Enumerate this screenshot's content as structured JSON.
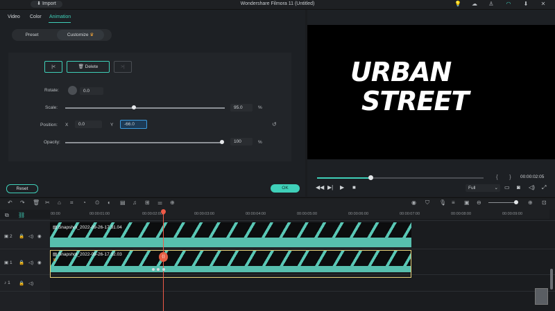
{
  "titlebar": {
    "import_label": "Import",
    "app_title": "Wondershare Filmora 11 (Untitled)"
  },
  "panel": {
    "tabs": [
      "Video",
      "Color",
      "Animation"
    ],
    "active_tab": "Animation",
    "subtabs": [
      "Preset",
      "Customize"
    ],
    "active_subtab": "Customize",
    "keyframe": {
      "delete_label": "Delete"
    },
    "rotate": {
      "label": "Rotate:",
      "value": "0.0"
    },
    "scale": {
      "label": "Scale:",
      "value": "95.0",
      "unit": "%",
      "level": 0.43
    },
    "position": {
      "label": "Position:",
      "x_label": "X",
      "x_value": "0.0",
      "y_label": "Y",
      "y_value": "-66.0"
    },
    "opacity": {
      "label": "Opacity:",
      "value": "100",
      "unit": "%",
      "level": 1.0
    },
    "reset_label": "Reset",
    "ok_label": "OK"
  },
  "preview": {
    "title_line1": "URBAN",
    "title_line2": "STREET",
    "timecode": "00:00:02:05",
    "progress": 0.32,
    "zoom": "Full"
  },
  "timeline": {
    "ruler": [
      "00:00",
      "00:00:01:00",
      "00:00:02:00",
      "00:00:03:00",
      "00:00:04:00",
      "00:00:05:00",
      "00:00:06:00",
      "00:00:07:00",
      "00:00:08:00",
      "00:00:09:00"
    ],
    "tracks": [
      {
        "number": "2",
        "clip_name": "Snapshot_2022-09-26-17.31.04"
      },
      {
        "number": "1",
        "clip_name": "Snapshot_2022-09-26-17.32.03"
      },
      {
        "number": "1",
        "clip_name": ""
      }
    ]
  },
  "colors": {
    "accent": "#3fd0b9",
    "playhead": "#ef5a47"
  }
}
